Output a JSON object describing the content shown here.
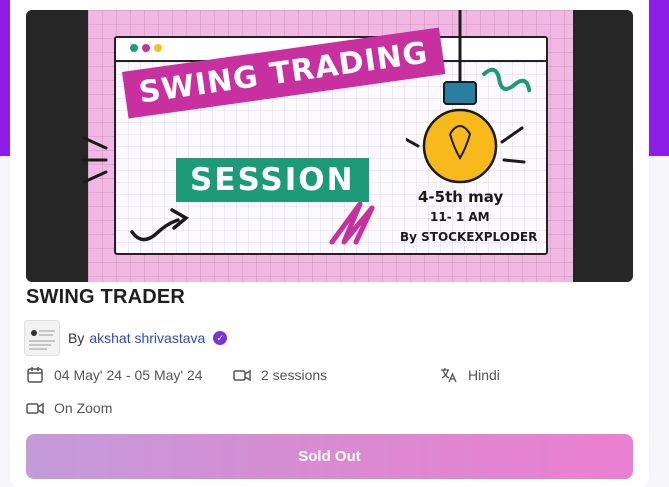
{
  "banner": {
    "title_line1": "SWING TRADING",
    "title_line2": "SESSION",
    "dates": "4-5th  may",
    "time": "11- 1 AM",
    "byline": "By STOCKEXPLODER"
  },
  "course": {
    "title": "SWING TRADER",
    "by_label": "By",
    "author": "akshat shrivastava",
    "date_range": "04 May' 24 - 05 May' 24",
    "sessions": "2 sessions",
    "language": "Hindi",
    "platform": "On Zoom"
  },
  "actions": {
    "sold_out_label": "Sold Out"
  },
  "icons": {
    "date": "calendar-icon",
    "sessions": "video-icon",
    "language": "translate-icon",
    "platform": "video-icon",
    "verified": "verified-badge-icon"
  },
  "colors": {
    "top_background": "#8d1ee8",
    "author_link": "#2a4bc9",
    "verified_badge": "#7a35d6",
    "button_gradient_start": "#c49bd9",
    "button_gradient_end": "#ea7fd0"
  }
}
